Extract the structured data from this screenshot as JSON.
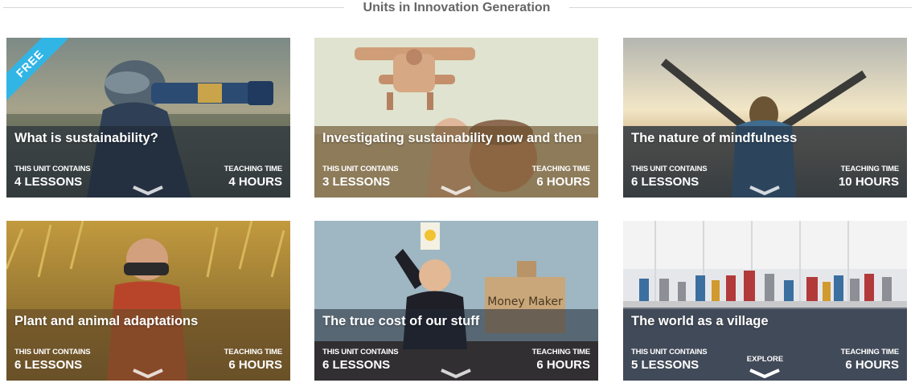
{
  "page": {
    "heading": "Units in Innovation Generation"
  },
  "units": [
    {
      "title": "What is sustainability?",
      "badge": "FREE",
      "contains_label": "THIS UNIT CONTAINS",
      "lessons": "4 LESSONS",
      "time_label": "TEACHING TIME",
      "time": "4 HOURS",
      "image": "child-aviator-telescope"
    },
    {
      "title": "Investigating sustainability now and then",
      "contains_label": "THIS UNIT CONTAINS",
      "lessons": "3 LESSONS",
      "time_label": "TEACHING TIME",
      "time": "6 HOURS",
      "image": "child-wooden-plane"
    },
    {
      "title": "The nature of mindfulness",
      "contains_label": "THIS UNIT CONTAINS",
      "lessons": "6 LESSONS",
      "time_label": "TEACHING TIME",
      "time": "10 HOURS",
      "image": "woman-arms-raised-sunset"
    },
    {
      "title": "Plant and animal adaptations",
      "contains_label": "THIS UNIT CONTAINS",
      "lessons": "6 LESSONS",
      "time_label": "TEACHING TIME",
      "time": "6 HOURS",
      "image": "child-binoculars-grass"
    },
    {
      "title": "The true cost of our stuff",
      "contains_label": "THIS UNIT CONTAINS",
      "lessons": "6 LESSONS",
      "time_label": "TEACHING TIME",
      "time": "6 HOURS",
      "image": "child-lightbulb-money-maker",
      "box_text": "Money Maker"
    },
    {
      "title": "The world as a village",
      "contains_label": "THIS UNIT CONTAINS",
      "lessons": "5 LESSONS",
      "time_label": "TEACHING TIME",
      "time": "6 HOURS",
      "image": "toy-robots-shelf",
      "hover_label": "EXPLORE"
    }
  ],
  "colors": {
    "overlay_dark": "rgba(30,38,52,0.62)",
    "overlay_warm": "rgba(105,78,40,0.62)",
    "free_badge": "#31b5e5"
  }
}
